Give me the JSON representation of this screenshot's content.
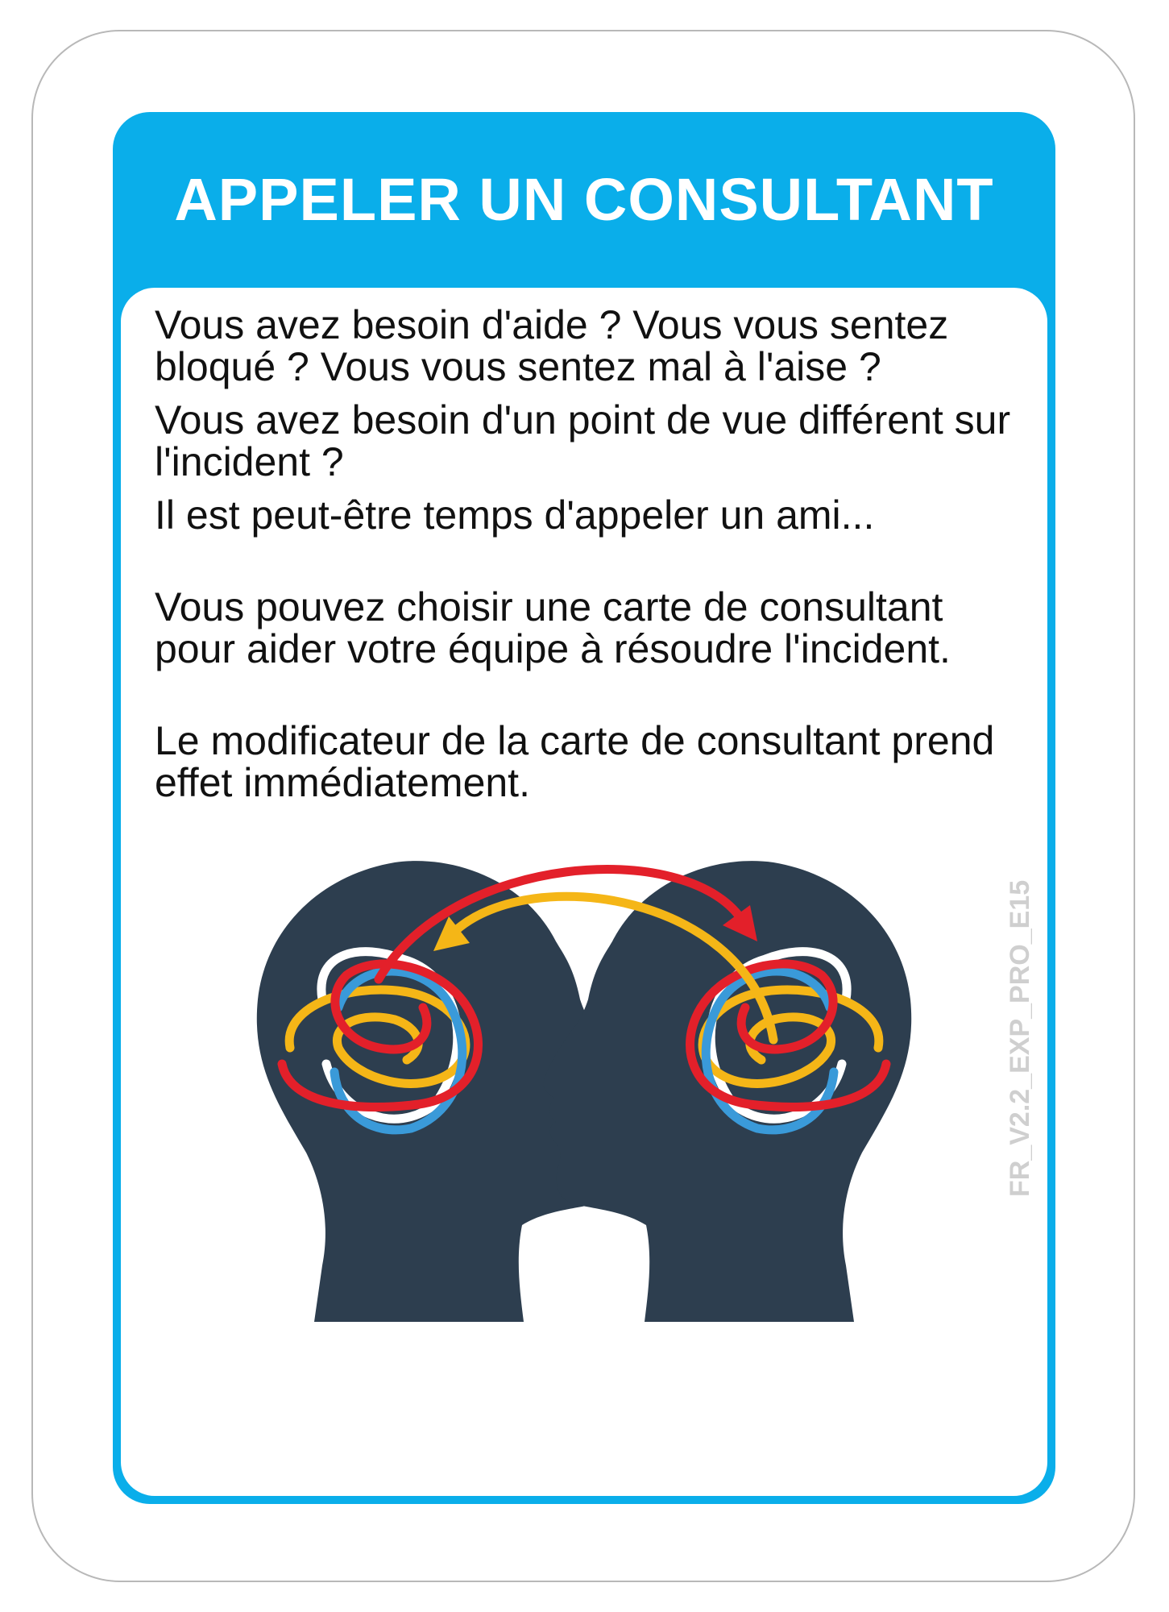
{
  "card": {
    "title": "APPELER UN CONSULTANT",
    "paragraphs": [
      "Vous avez besoin d'aide ? Vous vous sentez bloqué ? Vous vous sentez mal à l'aise ?",
      "Vous avez besoin d'un point de vue différent sur l'incident ?",
      "Il est peut-être temps d'appeler un ami...",
      "Vous pouvez choisir une carte de consultant pour aider votre équipe à résoudre l'incident.",
      "Le modificateur de la carte de consultant prend effet immédiatement."
    ],
    "card_code": "FR_V2.2_EXP_PRO_E15"
  },
  "colors": {
    "accent": "#0aaeea",
    "head": "#2d3e4f",
    "red": "#e3202a",
    "yellow": "#f5b617",
    "blue": "#3a9ad9"
  },
  "illustration": {
    "icon": "two-heads-exchanging-thoughts-icon"
  }
}
